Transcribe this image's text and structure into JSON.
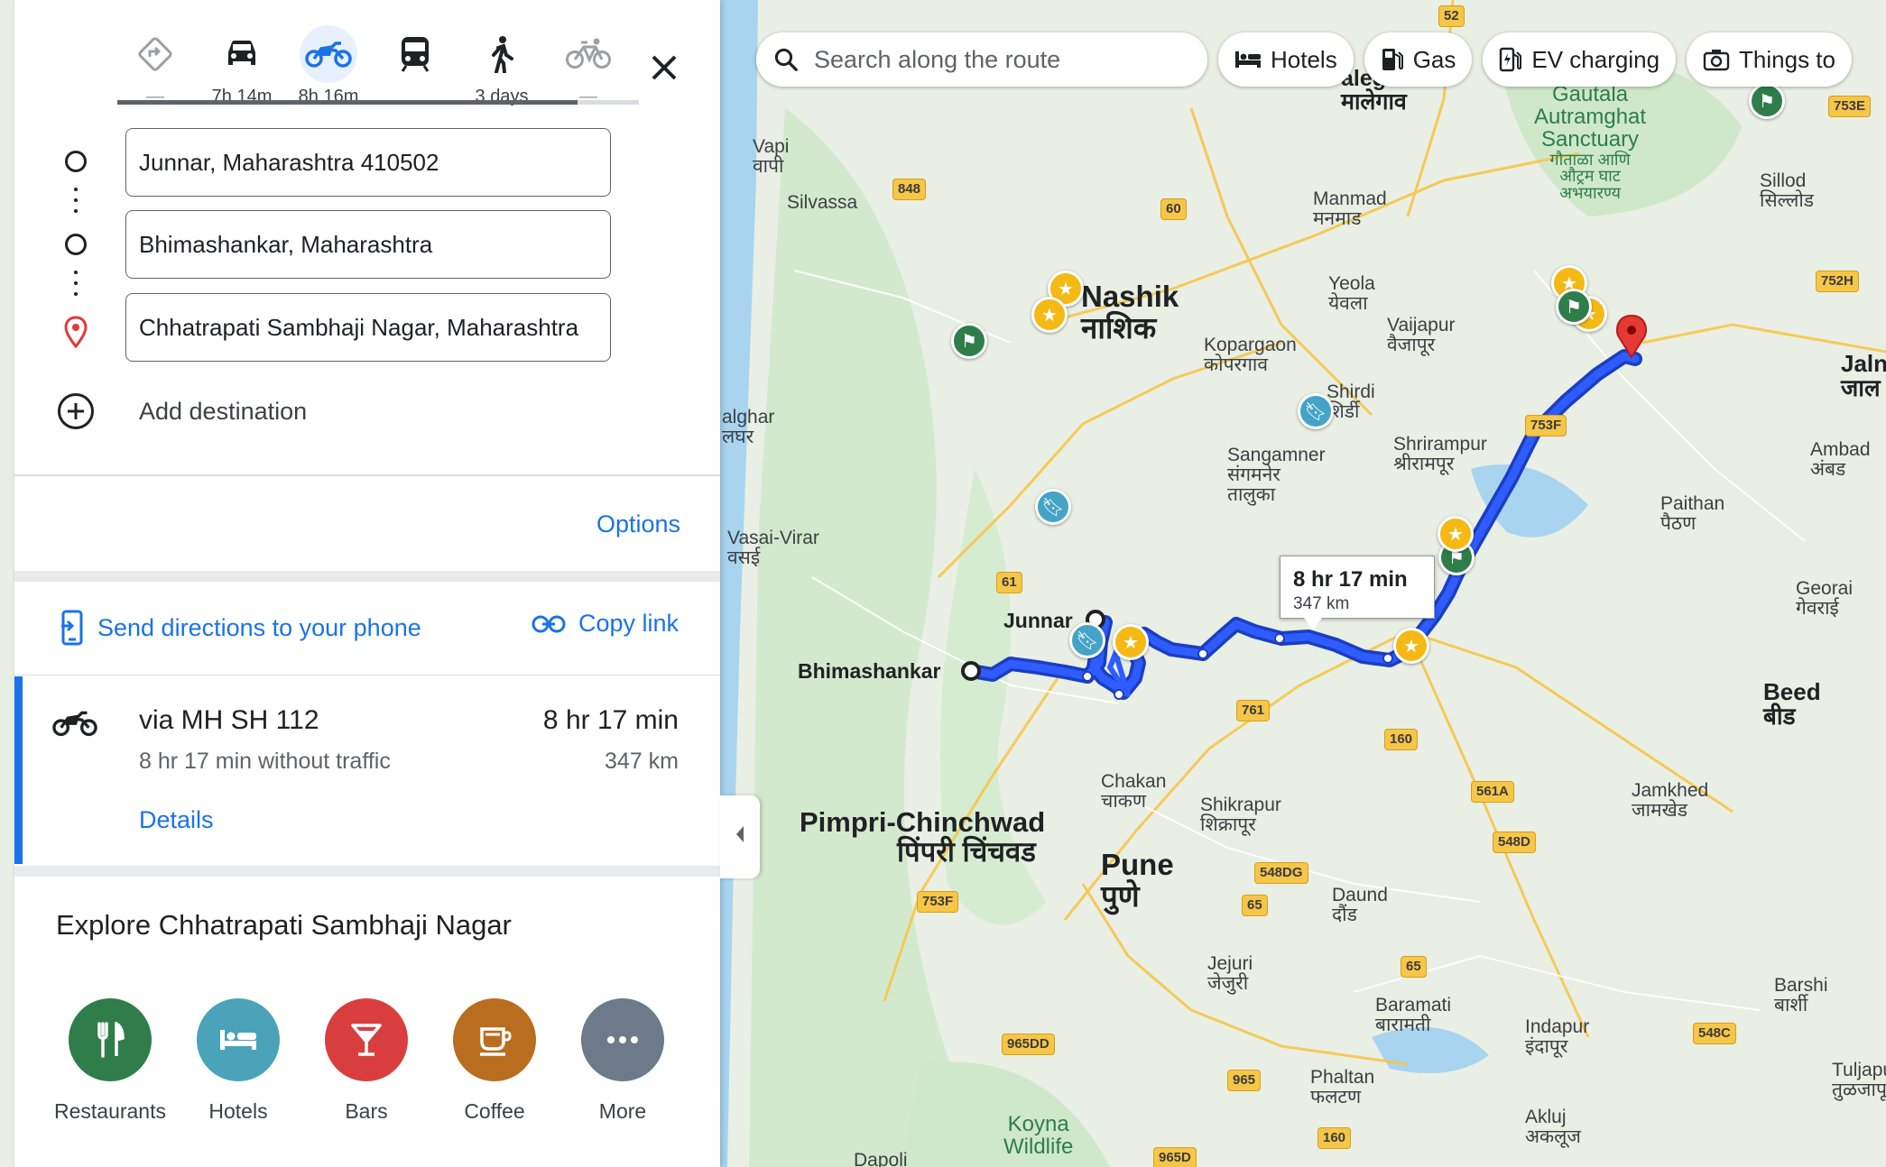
{
  "search": {
    "placeholder": "Search along the route"
  },
  "chips": {
    "hotels": "Hotels",
    "gas": "Gas",
    "ev": "EV charging",
    "things": "Things to"
  },
  "travel_modes": [
    {
      "name": "best",
      "label": "—"
    },
    {
      "name": "drive",
      "label": "7h 14m"
    },
    {
      "name": "two-wheeler",
      "label": "8h 16m"
    },
    {
      "name": "transit",
      "label": ""
    },
    {
      "name": "walk",
      "label": "3 days"
    },
    {
      "name": "bicycle",
      "label": "—"
    }
  ],
  "stops": [
    {
      "value": "Junnar, Maharashtra 410502"
    },
    {
      "value": "Bhimashankar, Maharashtra"
    },
    {
      "value": "Chhatrapati Sambhaji Nagar, Maharashtra"
    }
  ],
  "add_destination": "Add destination",
  "options_label": "Options",
  "send_directions": "Send directions to your phone",
  "copy_link": "Copy link",
  "route": {
    "via": "via MH SH 112",
    "time": "8 hr 17 min",
    "without_traffic": "8 hr 17 min without traffic",
    "distance": "347 km",
    "details": "Details"
  },
  "explore": {
    "title": "Explore Chhatrapati Sambhaji Nagar",
    "categories": [
      {
        "label": "Restaurants",
        "color": "#2f7d4b",
        "icon": "restaurant-icon"
      },
      {
        "label": "Hotels",
        "color": "#4aa3b8",
        "icon": "hotel-icon"
      },
      {
        "label": "Bars",
        "color": "#d93e3e",
        "icon": "bar-icon"
      },
      {
        "label": "Coffee",
        "color": "#b96d1e",
        "icon": "coffee-icon"
      },
      {
        "label": "More",
        "color": "#6c7a89",
        "icon": "more-icon"
      }
    ]
  },
  "map": {
    "tooltip": {
      "time": "8 hr 17 min",
      "distance": "347 km"
    },
    "places": {
      "nashik": {
        "en": "Nashik",
        "local": "नाशिक"
      },
      "malegaon": {
        "en": "alegaon",
        "local": "मालेगाव"
      },
      "manmad": {
        "en": "Manmad",
        "local": "मनमाड"
      },
      "yeola": {
        "en": "Yeola",
        "local": "येवला"
      },
      "kopargaon": {
        "en": "Kopargaon",
        "local": "कोपरगाव"
      },
      "vaijapur": {
        "en": "Vaijapur",
        "local": "वैजापूर"
      },
      "shirdi": {
        "en": "Shirdi",
        "local": "शिर्डी"
      },
      "sangamner": {
        "en": "Sangamner",
        "local": "संगमनेर",
        "local2": "तालुका"
      },
      "shrirampur": {
        "en": "Shrirampur",
        "local": "श्रीरामपूर"
      },
      "vapi": {
        "en": "Vapi",
        "local": "वापी"
      },
      "silvassa": {
        "en": "Silvassa"
      },
      "palghar": {
        "en": "alghar",
        "local": "लघर"
      },
      "vasai": {
        "en": "Vasai-Virar",
        "local": "वसई"
      },
      "junnar": {
        "en": "Junnar"
      },
      "bhimashankar": {
        "en": "Bhimashankar"
      },
      "chakan": {
        "en": "Chakan",
        "local": "चाकण"
      },
      "shikrapur": {
        "en": "Shikrapur",
        "local": "शिक्रापूर"
      },
      "pimpri": {
        "en": "Pimpri-Chinchwad",
        "local": "पिंपरी चिंचवड"
      },
      "pune": {
        "en": "Pune",
        "local": "पुणे"
      },
      "daund": {
        "en": "Daund",
        "local": "दौंड"
      },
      "jejuri": {
        "en": "Jejuri",
        "local": "जेजुरी"
      },
      "baramati": {
        "en": "Baramati",
        "local": "बारामती"
      },
      "indapur": {
        "en": "Indapur",
        "local": "इंदापूर"
      },
      "phaltan": {
        "en": "Phaltan",
        "local": "फलटण"
      },
      "akluj": {
        "en": "Akluj",
        "local": "अकलूज"
      },
      "koyna": {
        "en": "Koyna",
        "local": "Wildlife"
      },
      "dapoli": {
        "en": "Dapoli"
      },
      "paithan": {
        "en": "Paithan",
        "local": "पैठण"
      },
      "ambad": {
        "en": "Ambad",
        "local": "अंबड"
      },
      "jalna": {
        "en": "Jaln",
        "local": "जाल"
      },
      "georai": {
        "en": "Georai",
        "local": "गेवराई"
      },
      "beed": {
        "en": "Beed",
        "local": "बीड"
      },
      "jamkhed": {
        "en": "Jamkhed",
        "local": "जामखेड"
      },
      "barshi": {
        "en": "Barshi",
        "local": "बार्शी"
      },
      "tuljapur": {
        "en": "Tuljapur",
        "local": "तुळजापूर"
      },
      "sillod": {
        "en": "Sillod",
        "local": "सिल्लोड"
      },
      "gautala": {
        "en": "Gautala",
        "en2": "Autramghat",
        "en3": "Sanctuary",
        "local": "गौताळा आणि",
        "local2": "औट्रम घाट",
        "local3": "अभयारण्य"
      }
    },
    "shields": {
      "s52": "52",
      "s848": "848",
      "s60": "60",
      "s753e": "753E",
      "s752h": "752H",
      "s753f": "753F",
      "s61": "61",
      "s761": "761",
      "s160a": "160",
      "s561a": "561A",
      "s548d": "548D",
      "s548dg": "548DG",
      "s65a": "65",
      "s753f2": "753F",
      "s65b": "65",
      "s965dd": "965DD",
      "s965": "965",
      "s160b": "160",
      "s548c": "548C",
      "s965d": "965D"
    }
  }
}
